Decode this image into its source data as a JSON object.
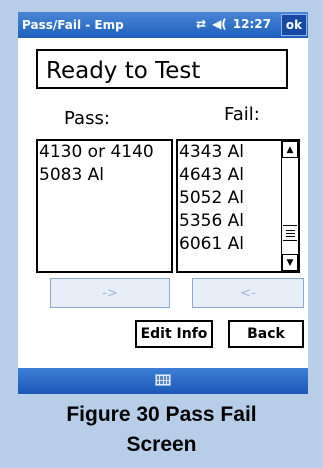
{
  "titlebar": {
    "title": "Pass/Fail - Emp",
    "time": "12:27",
    "ok_label": "ok"
  },
  "status_text": "Ready to Test",
  "pass": {
    "label": "Pass:",
    "items": [
      "4130 or 4140",
      "5083 Al"
    ]
  },
  "fail": {
    "label": "Fail:",
    "items": [
      "4343 Al",
      "4643 Al",
      "5052 Al",
      "5356 Al",
      "6061 Al"
    ]
  },
  "buttons": {
    "move_to_pass": "->",
    "move_to_fail": "<-",
    "edit_info": "Edit Info",
    "back": "Back"
  },
  "icons": {
    "signal": "connectivity-icon",
    "volume": "speaker-icon",
    "keyboard": "keyboard-icon"
  },
  "caption": {
    "line1": "Figure 30  Pass Fail",
    "line2": "Screen"
  }
}
